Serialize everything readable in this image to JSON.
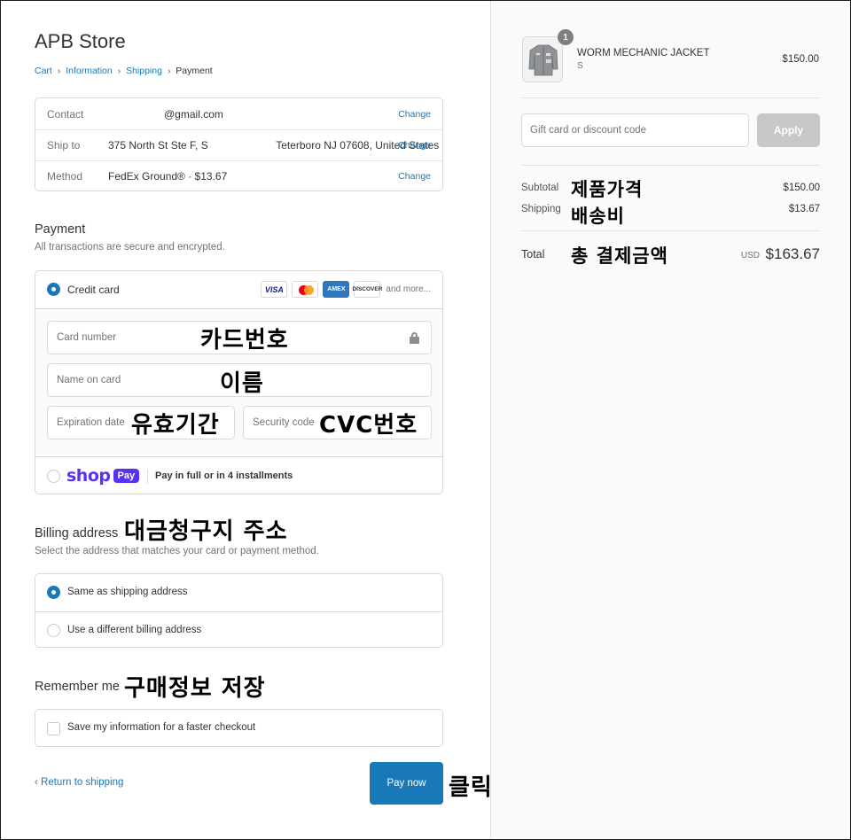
{
  "store": {
    "title": "APB Store"
  },
  "breadcrumb": {
    "cart": "Cart",
    "information": "Information",
    "shipping": "Shipping",
    "payment": "Payment",
    "separator": "›"
  },
  "info": {
    "contact_label": "Contact",
    "contact_value": "@gmail.com",
    "ship_label": "Ship to",
    "ship_value": "375 North St Ste F, S                       Teterboro NJ 07608, United States",
    "method_label": "Method",
    "method_value": "FedEx Ground® · $13.67",
    "change": "Change"
  },
  "payment": {
    "title": "Payment",
    "subtitle": "All transactions are secure and encrypted.",
    "credit_card_label": "Credit card",
    "brands": {
      "visa": "VISA",
      "amex": "AMEX",
      "discover": "DISCOVER",
      "more": "and more..."
    },
    "card_number_placeholder": "Card number",
    "name_placeholder": "Name on card",
    "expiration_placeholder": "Expiration date",
    "security_placeholder": "Security code",
    "shop_word": "shop",
    "shop_pay": "Pay",
    "shop_text": "Pay in full or in 4 installments"
  },
  "billing": {
    "title": "Billing address",
    "subtitle": "Select the address that matches your card or payment method.",
    "same": "Same as shipping address",
    "different": "Use a different billing address"
  },
  "remember": {
    "title": "Remember me",
    "checkbox_label": "Save my information for a faster checkout"
  },
  "actions": {
    "return": "‹ Return to shipping",
    "pay_now": "Pay now"
  },
  "annotations": {
    "card_number": "카드번호",
    "name": "이름",
    "expiration": "유효기간",
    "cvc": "CVC번호",
    "billing": "대금청구지 주소",
    "remember": "구매정보 저장",
    "click": "클릭",
    "subtotal": "제품가격",
    "shipping": "배송비",
    "total": "총 결제금액"
  },
  "order": {
    "quantity": "1",
    "product_name": "WORM MECHANIC JACKET",
    "variant": "S",
    "price": "$150.00",
    "discount_placeholder": "Gift card or discount code",
    "apply": "Apply",
    "subtotal_label": "Subtotal",
    "subtotal_value": "$150.00",
    "shipping_label": "Shipping",
    "shipping_value": "$13.67",
    "total_label": "Total",
    "currency": "USD",
    "total_value": "$163.67"
  },
  "colors": {
    "accent": "#1979b8",
    "shop_pay": "#5a31f4",
    "apply_disabled": "#c8c8c8"
  }
}
